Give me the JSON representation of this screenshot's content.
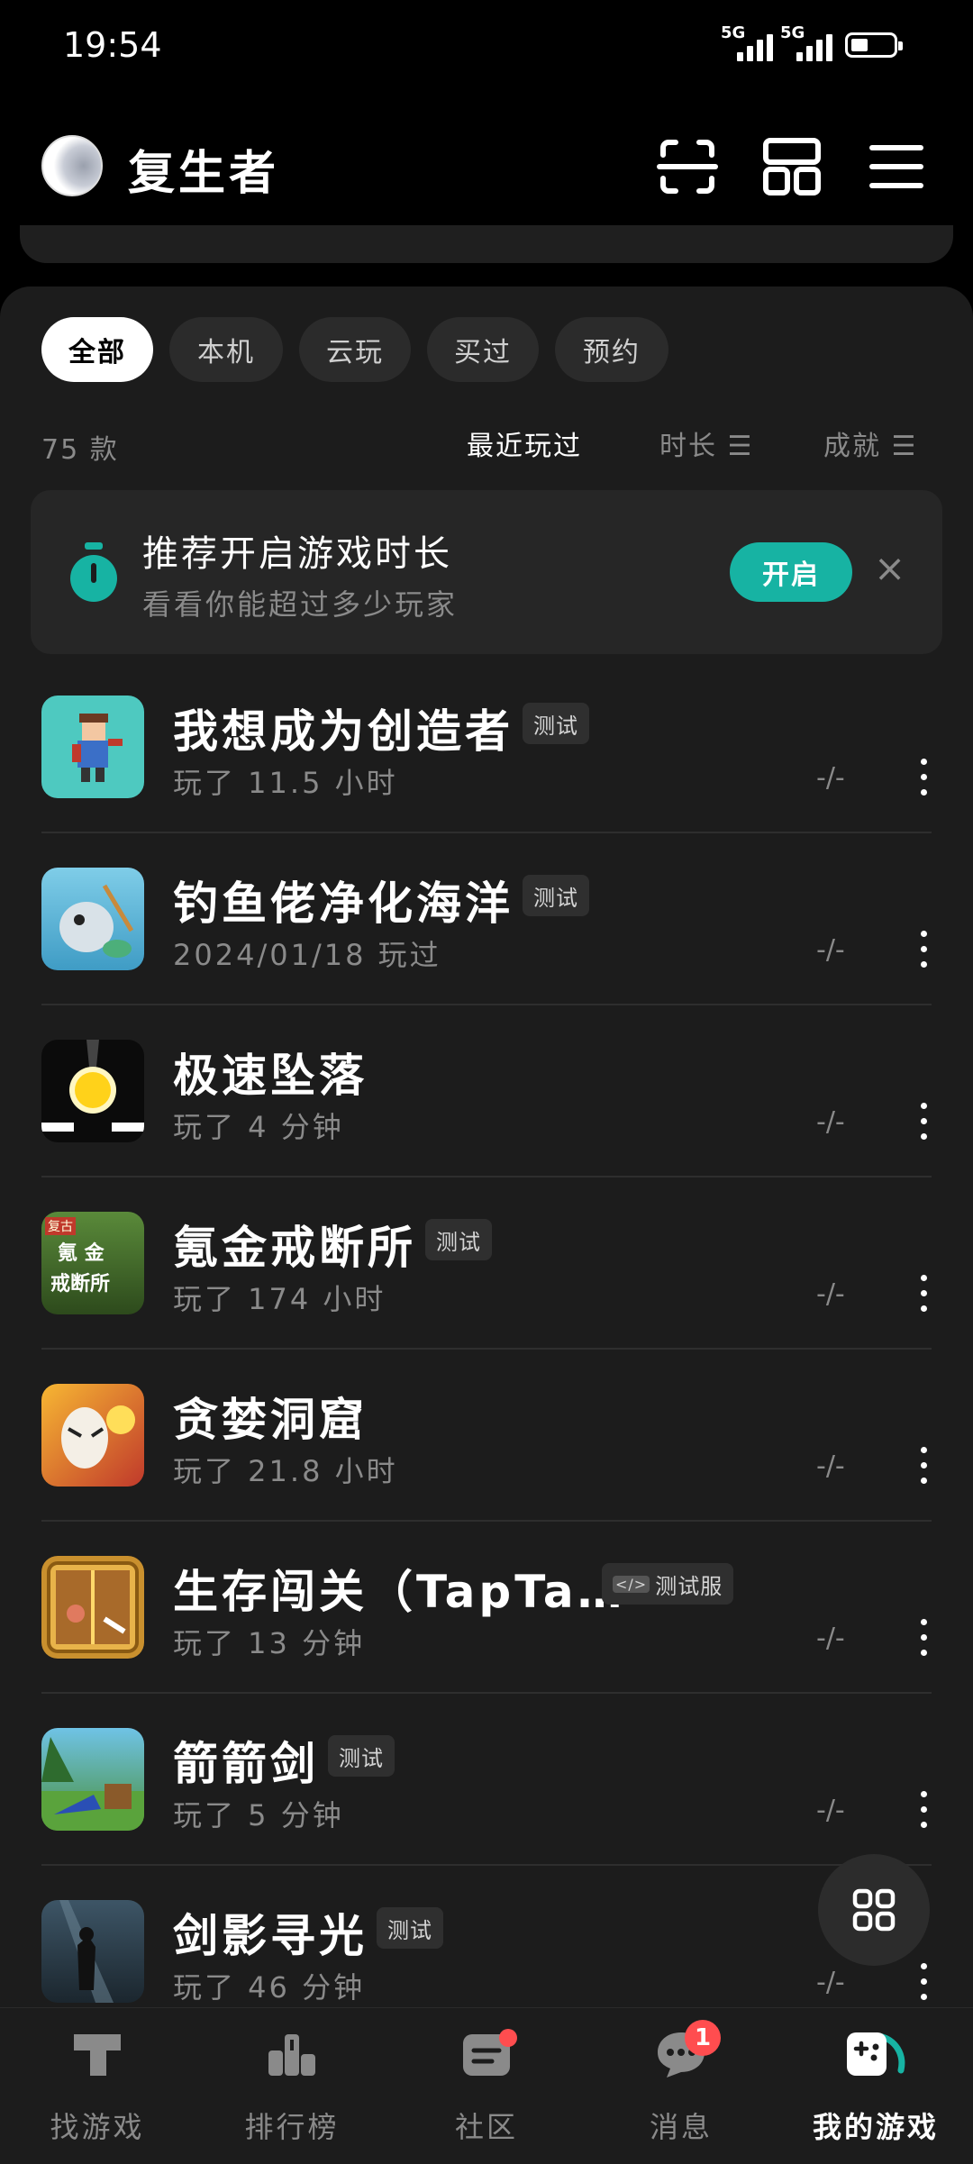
{
  "status_bar": {
    "time": "19:54",
    "network1": "5G",
    "network2": "5G"
  },
  "header": {
    "username": "复生者",
    "icons": [
      "scan-icon",
      "layout-icon",
      "menu-icon"
    ]
  },
  "filters": [
    {
      "label": "全部",
      "active": true
    },
    {
      "label": "本机",
      "active": false
    },
    {
      "label": "云玩",
      "active": false
    },
    {
      "label": "买过",
      "active": false
    },
    {
      "label": "预约",
      "active": false
    }
  ],
  "list_info": {
    "count": "75 款",
    "sort_options": [
      "最近玩过",
      "时长 ☰",
      "成就 ☰"
    ]
  },
  "recommend": {
    "title": "推荐开启游戏时长",
    "subtitle": "看看你能超过多少玩家",
    "button": "开启",
    "close": "×"
  },
  "games": [
    {
      "name": "我想成为创造者",
      "tag": "测试",
      "meta": "玩了 11.5 小时",
      "achievement": "-/-"
    },
    {
      "name": "钓鱼佬净化海洋",
      "tag": "测试",
      "meta": "2024/01/18 玩过",
      "achievement": "-/-"
    },
    {
      "name": "极速坠落",
      "tag": "",
      "meta": "玩了 4 分钟",
      "achievement": "-/-"
    },
    {
      "name": "氪金戒断所",
      "tag": "测试",
      "meta": "玩了 174 小时",
      "achievement": "-/-"
    },
    {
      "name": "贪婪洞窟",
      "tag": "",
      "meta": "玩了 21.8 小时",
      "achievement": "-/-"
    },
    {
      "name": "生存闯关（TapTa…",
      "tag": "测试服",
      "meta": "玩了 13 分钟",
      "achievement": "-/-"
    },
    {
      "name": "箭箭剑",
      "tag": "测试",
      "meta": "玩了 5 分钟",
      "achievement": "-/-"
    },
    {
      "name": "剑影寻光",
      "tag": "测试",
      "meta": "玩了 46 分钟",
      "achievement": "-/-"
    }
  ],
  "icon_texts": {
    "game4_top": "复古",
    "game4_mid": "氪 金",
    "game4_bottom": "戒断所",
    "tag_code": "</>"
  },
  "bottom_nav": [
    {
      "label": "找游戏"
    },
    {
      "label": "排行榜"
    },
    {
      "label": "社区"
    },
    {
      "label": "消息",
      "badge": "1"
    },
    {
      "label": "我的游戏"
    }
  ],
  "colors": {
    "accent": "#17b3a3",
    "badge": "#ff4d4f",
    "panel": "#1c1c1c"
  }
}
